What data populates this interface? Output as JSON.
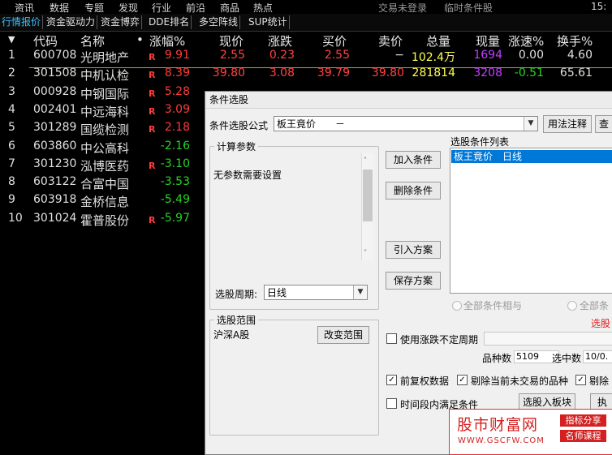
{
  "menu": {
    "items": [
      "资讯",
      "数据",
      "专题",
      "发现",
      "行业",
      "前沿",
      "商品",
      "热点"
    ],
    "login": "交易未登录",
    "board": "临时条件股",
    "time": "15:"
  },
  "tabs": [
    "行情报价",
    "资金驱动力",
    "资金博弈",
    "DDE排名",
    "多空阵线",
    "SUP统计"
  ],
  "columns": {
    "idx": "▼",
    "code": "代码",
    "name": "名称",
    "dot": "•",
    "pct": "涨幅%",
    "price": "现价",
    "change": "涨跌",
    "buy": "买价",
    "sell": "卖价",
    "volume": "总量",
    "current": "现量",
    "speed": "涨速%",
    "turnover": "换手%"
  },
  "rows": [
    {
      "idx": "1",
      "code": "600708",
      "name": "光明地产",
      "r": "R",
      "pct": "9.91",
      "price": "2.55",
      "change": "0.23",
      "buy": "2.55",
      "sell": "−",
      "vol": "102.4万",
      "cur": "1694",
      "spd": "0.00",
      "turn": "4.60"
    },
    {
      "idx": "2",
      "code": "301508",
      "name": "中机认检",
      "r": "R",
      "pct": "8.39",
      "price": "39.80",
      "change": "3.08",
      "buy": "39.79",
      "sell": "39.80",
      "vol": "281814",
      "cur": "3208",
      "spd": "-0.51",
      "turn": "65.61"
    },
    {
      "idx": "3",
      "code": "000928",
      "name": "中钢国际",
      "r": "R",
      "pct": "5.28",
      "price": "",
      "change": "",
      "buy": "",
      "sell": "",
      "vol": "",
      "cur": "",
      "spd": "",
      "turn": ""
    },
    {
      "idx": "4",
      "code": "002401",
      "name": "中远海科",
      "r": "R",
      "pct": "3.09",
      "price": "",
      "change": "",
      "buy": "",
      "sell": "",
      "vol": "",
      "cur": "",
      "spd": "",
      "turn": ""
    },
    {
      "idx": "5",
      "code": "301289",
      "name": "国缆检测",
      "r": "R",
      "pct": "2.18",
      "price": "",
      "change": "",
      "buy": "",
      "sell": "",
      "vol": "",
      "cur": "",
      "spd": "",
      "turn": ""
    },
    {
      "idx": "6",
      "code": "603860",
      "name": "中公高科",
      "r": "",
      "pct": "-2.16",
      "price": "",
      "change": "",
      "buy": "",
      "sell": "",
      "vol": "",
      "cur": "",
      "spd": "",
      "turn": ""
    },
    {
      "idx": "7",
      "code": "301230",
      "name": "泓博医药",
      "r": "R",
      "pct": "-3.10",
      "price": "",
      "change": "",
      "buy": "",
      "sell": "",
      "vol": "",
      "cur": "",
      "spd": "",
      "turn": ""
    },
    {
      "idx": "8",
      "code": "603122",
      "name": "合富中国",
      "r": "",
      "pct": "-3.53",
      "price": "",
      "change": "",
      "buy": "",
      "sell": "",
      "vol": "",
      "cur": "",
      "spd": "",
      "turn": ""
    },
    {
      "idx": "9",
      "code": "603918",
      "name": "金桥信息",
      "r": "",
      "pct": "-5.49",
      "price": "",
      "change": "",
      "buy": "",
      "sell": "",
      "vol": "",
      "cur": "",
      "spd": "",
      "turn": ""
    },
    {
      "idx": "10",
      "code": "301024",
      "name": "霍普股份",
      "r": "R",
      "pct": "-5.97",
      "price": "",
      "change": "",
      "buy": "",
      "sell": "",
      "vol": "",
      "cur": "",
      "spd": "",
      "turn": ""
    }
  ],
  "dialog": {
    "title": "条件选股",
    "formula_label": "条件选股公式",
    "formula_value": "板王竟价　　－",
    "usage_button": "用法注释",
    "view_button": "查",
    "calc_group": "计算参数",
    "calc_text": "无参数需要设置",
    "period_label": "选股周期:",
    "period_value": "日线",
    "add_button": "加入条件",
    "delete_button": "删除条件",
    "import_button": "引入方案",
    "save_button": "保存方案",
    "list_title": "选股条件列表",
    "list_item": "板王竟价　日线",
    "radio_and": "全部条件相与",
    "radio_or": "全部条",
    "red_text": "选股",
    "range_group": "选股范围",
    "range_value": "沪深A股",
    "range_button": "改变范围",
    "use_period_label": "使用涨跌不定周期",
    "count_label": "品种数",
    "count_value": "5109",
    "selected_label": "选中数",
    "selected_value": "10/0.",
    "fq_label": "前复权数据",
    "exclude_label": "剔除当前未交易的品种",
    "exclude2_label": "剔除",
    "time_label": "时间段内满足条件",
    "select_button": "选股入板块",
    "exec_button": "执"
  },
  "watermark": {
    "title": "股市财富网",
    "tag1": "指标分享",
    "tag2": "名师课程",
    "url": "WWW.GSCFW.COM"
  },
  "colors": {
    "up": "#ff3b3b",
    "down": "#26d426",
    "volume": "#ffff55",
    "current": "#c040ff",
    "tab_active": "#39c0ff",
    "selection": "#0078d7",
    "brand": "#d42020"
  }
}
